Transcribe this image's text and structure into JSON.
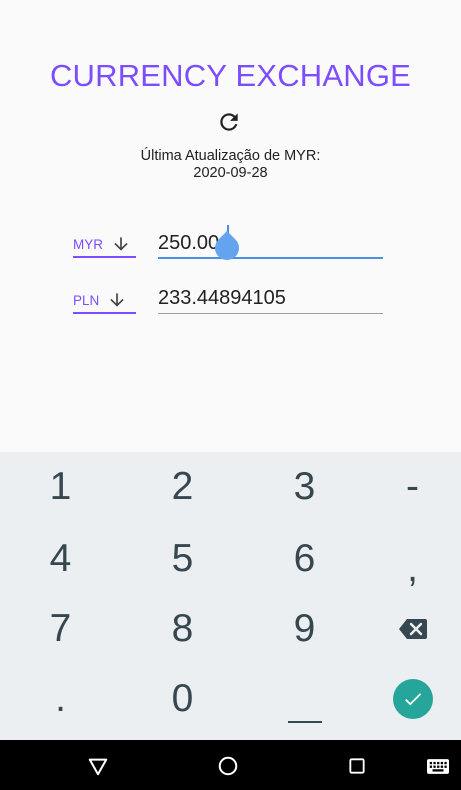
{
  "app": {
    "title": "CURRENCY EXCHANGE",
    "refresh_icon": "refresh-icon",
    "last_update_label": "Última Atualização de MYR:",
    "last_update_date": "2020-09-28",
    "accent_color": "#7c4dff"
  },
  "rows": [
    {
      "currency": "MYR",
      "amount": "250.00",
      "active": true
    },
    {
      "currency": "PLN",
      "amount": "233.44894105",
      "active": false
    }
  ],
  "keyboard": {
    "keys": [
      "1",
      "2",
      "3",
      "-",
      "4",
      "5",
      "6",
      ",",
      "7",
      "8",
      "9",
      "backspace",
      ".",
      "0",
      "space",
      "done"
    ],
    "done_color": "#26a69a"
  },
  "navbar": {
    "icons": [
      "back-icon",
      "home-icon",
      "recents-icon",
      "keyboard-icon"
    ]
  }
}
